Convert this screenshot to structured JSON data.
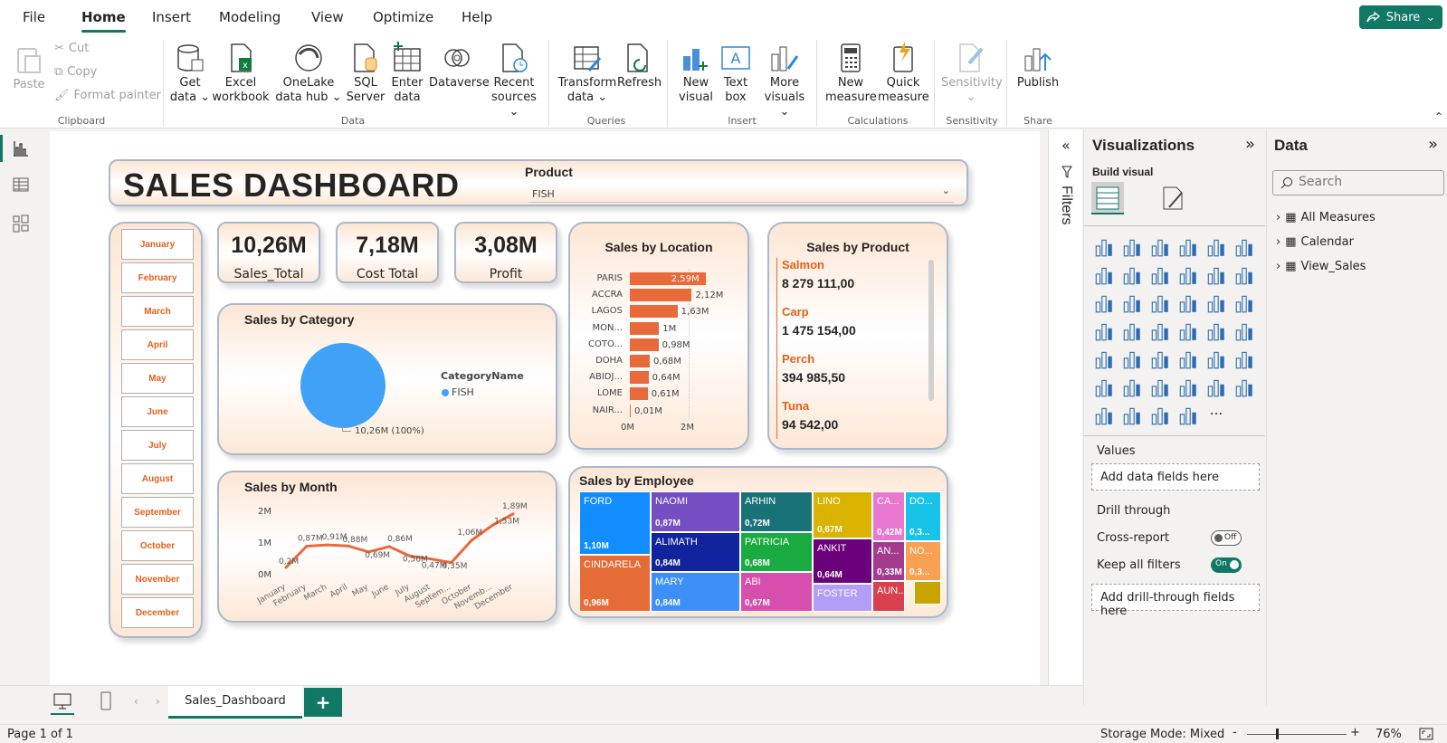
{
  "menu": {
    "tabs": [
      "File",
      "Home",
      "Insert",
      "Modeling",
      "View",
      "Optimize",
      "Help"
    ],
    "active": "Home",
    "share_label": "Share"
  },
  "ribbon": {
    "clipboard": {
      "paste": "Paste",
      "cut": "Cut",
      "copy": "Copy",
      "format_painter": "Format painter",
      "group": "Clipboard"
    },
    "data": {
      "get_data": "Get data",
      "excel": "Excel workbook",
      "onelake": "OneLake data hub",
      "sql": "SQL Server",
      "enter": "Enter data",
      "dataverse": "Dataverse",
      "recent": "Recent sources",
      "group": "Data"
    },
    "queries": {
      "transform": "Transform data",
      "refresh": "Refresh",
      "group": "Queries"
    },
    "insert": {
      "new_visual": "New visual",
      "text_box": "Text box",
      "more_visuals": "More visuals",
      "group": "Insert"
    },
    "calculations": {
      "new_measure": "New measure",
      "quick_measure": "Quick measure",
      "group": "Calculations"
    },
    "sensitivity": {
      "label": "Sensitivity",
      "group": "Sensitivity"
    },
    "share": {
      "publish": "Publish",
      "group": "Share"
    }
  },
  "dashboard": {
    "title": "SALES DASHBOARD",
    "product_slicer": {
      "label": "Product",
      "value": "FISH"
    },
    "months": [
      "January",
      "February",
      "March",
      "April",
      "May",
      "June",
      "July",
      "August",
      "September",
      "October",
      "November",
      "December"
    ],
    "kpis": [
      {
        "value": "10,26M",
        "label": "Sales_Total"
      },
      {
        "value": "7,18M",
        "label": "Cost Total"
      },
      {
        "value": "3,08M",
        "label": "Profit"
      }
    ],
    "category": {
      "title": "Sales by Category",
      "legend_title": "CategoryName",
      "legend_item": "FISH",
      "data_label": "10,26M (100%)",
      "color": "#3fa2f7"
    },
    "location": {
      "title": "Sales by Location",
      "axis_ticks": [
        "0M",
        "2M"
      ]
    },
    "product": {
      "title": "Sales by Product",
      "items": [
        {
          "name": "Salmon",
          "value": "8 279 111,00"
        },
        {
          "name": "Carp",
          "value": "1 475 154,00"
        },
        {
          "name": "Perch",
          "value": "394 985,50"
        },
        {
          "name": "Tuna",
          "value": "94 542,00"
        }
      ]
    },
    "month_chart": {
      "title": "Sales by Month",
      "y_ticks": [
        "2M",
        "1M",
        "0M"
      ]
    },
    "employee": {
      "title": "Sales by Employee",
      "tiles": [
        {
          "name": "FORD",
          "value": "1,10M",
          "color": "#118dff"
        },
        {
          "name": "CINDARELA",
          "value": "0,96M",
          "color": "#e66c37"
        },
        {
          "name": "NAOMI",
          "value": "0,87M",
          "color": "#744ec2"
        },
        {
          "name": "ALIMATH",
          "value": "0,84M",
          "color": "#12239e"
        },
        {
          "name": "MARY",
          "value": "0,84M",
          "color": "#3d90f7"
        },
        {
          "name": "ARHIN",
          "value": "0,72M",
          "color": "#197278"
        },
        {
          "name": "PATRICIA",
          "value": "0,68M",
          "color": "#1aab40"
        },
        {
          "name": "ABI",
          "value": "0,67M",
          "color": "#d64fac"
        },
        {
          "name": "LINO",
          "value": "0,67M",
          "color": "#d9b300"
        },
        {
          "name": "ANKIT",
          "value": "0,64M",
          "color": "#6b007b"
        },
        {
          "name": "FOSTER",
          "value": "",
          "color": "#b29df7"
        },
        {
          "name": "CA...",
          "value": "0,42M",
          "color": "#e979d0"
        },
        {
          "name": "AN...",
          "value": "0,33M",
          "color": "#a23b8e"
        },
        {
          "name": "AUN...",
          "value": "",
          "color": "#d9404e"
        },
        {
          "name": "DO...",
          "value": "0,3...",
          "color": "#17c3e6"
        },
        {
          "name": "NO...",
          "value": "0,3...",
          "color": "#f9a052"
        },
        {
          "name": "",
          "value": "",
          "color": "#c8a400"
        }
      ]
    }
  },
  "chart_data": [
    {
      "type": "bar",
      "title": "Sales by Location",
      "orientation": "horizontal",
      "categories": [
        "PARIS",
        "ACCRA",
        "LAGOS",
        "MON...",
        "COTO...",
        "DOHA",
        "ABIDJ...",
        "LOME",
        "NAIR..."
      ],
      "values": [
        2.59,
        2.12,
        1.63,
        1.0,
        0.98,
        0.68,
        0.64,
        0.61,
        0.01
      ],
      "labels": [
        "2,59M",
        "2,12M",
        "1,63M",
        "1M",
        "0,98M",
        "0,68M",
        "0,64M",
        "0,61M",
        "0,01M"
      ],
      "xlim": [
        0,
        2.6
      ],
      "color": "#e8693a"
    },
    {
      "type": "line",
      "title": "Sales by Month",
      "categories": [
        "January",
        "February",
        "March",
        "April",
        "May",
        "June",
        "July",
        "August",
        "Septem...",
        "October",
        "Novemb...",
        "December"
      ],
      "values": [
        0.2,
        0.87,
        0.91,
        0.88,
        0.69,
        0.86,
        0.56,
        0.47,
        0.35,
        1.06,
        1.53,
        1.89
      ],
      "labels": [
        "0,2M",
        "0,87M",
        "0,91M",
        "0,88M",
        "0,69M",
        "0,86M",
        "0,56M",
        "0,47M",
        "0,35M",
        "1,06M",
        "1,53M",
        "1,89M"
      ],
      "ylim": [
        0,
        2
      ],
      "color": "#e8693a"
    },
    {
      "type": "pie",
      "title": "Sales by Category",
      "categories": [
        "FISH"
      ],
      "values": [
        10.26
      ],
      "labels": [
        "10,26M (100%)"
      ]
    }
  ],
  "panes": {
    "filters": "Filters",
    "viz": {
      "title": "Visualizations",
      "build": "Build visual",
      "values": "Values",
      "add_data": "Add data fields here",
      "drill": "Drill through",
      "cross_report": "Cross-report",
      "cross_state": "Off",
      "keep_filters": "Keep all filters",
      "keep_state": "On",
      "add_drill": "Add drill-through fields here"
    },
    "data": {
      "title": "Data",
      "search_placeholder": "Search",
      "items": [
        "All Measures",
        "Calendar",
        "View_Sales"
      ]
    }
  },
  "tabs": {
    "page": "Sales_Dashboard",
    "add": "+"
  },
  "status": {
    "page": "Page 1 of 1",
    "storage": "Storage Mode: Mixed",
    "zoom": "76%"
  }
}
